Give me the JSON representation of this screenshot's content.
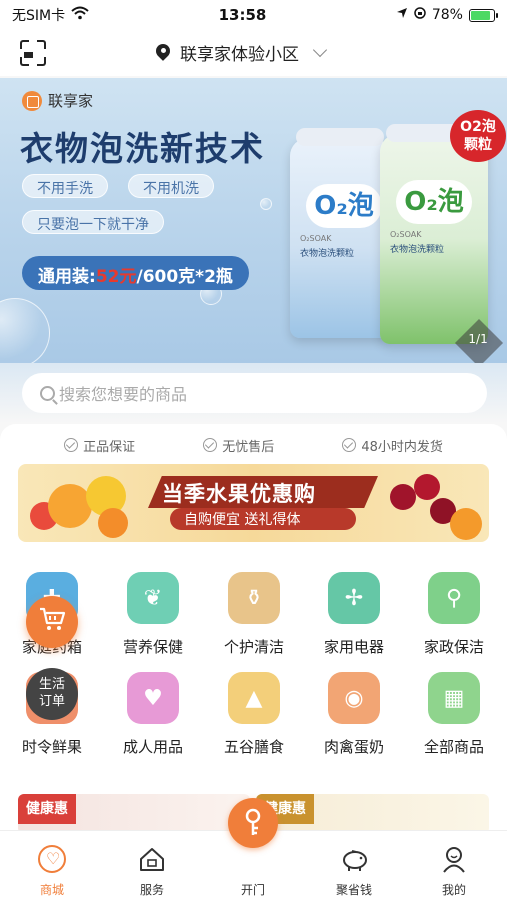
{
  "status_bar": {
    "carrier": "无SIM卡",
    "time": "13:58",
    "battery": "78%"
  },
  "header": {
    "location": "联享家体验小区"
  },
  "banner": {
    "brand": "联享家",
    "title": "衣物泡洗新技术",
    "pills": [
      "不用手洗",
      "不用机洗",
      "只要泡一下就干净"
    ],
    "price_prefix": "通用装:",
    "price_value": "52元",
    "price_suffix": "/600克*2瓶",
    "product_logo": "O₂泡",
    "product_name": "衣物泡洗颗粒",
    "product_brand": "O₂SOAK",
    "badge_line1": "O2泡",
    "badge_line2": "颗粒",
    "page_indicator": "1/1"
  },
  "search": {
    "placeholder": "搜索您想要的商品"
  },
  "guarantees": [
    "正品保证",
    "无忧售后",
    "48小时内发货"
  ],
  "fruit_banner": {
    "title": "当季水果优惠购",
    "subtitle": "自购便宜 送礼得体"
  },
  "categories": [
    {
      "label": "家庭药箱",
      "color": "#5aaee0",
      "icon": "medicine-box-icon"
    },
    {
      "label": "营养保健",
      "color": "#6fcfb4",
      "icon": "leaf-icon"
    },
    {
      "label": "个护清洁",
      "color": "#e8c48a",
      "icon": "lotion-bottle-icon"
    },
    {
      "label": "家用电器",
      "color": "#65c7a6",
      "icon": "fan-icon"
    },
    {
      "label": "家政保洁",
      "color": "#7fd08a",
      "icon": "broom-icon"
    },
    {
      "label": "时令鲜果",
      "color": "#ef8f6a",
      "icon": "fruit-icon"
    },
    {
      "label": "成人用品",
      "color": "#e79ad6",
      "icon": "heart-icon"
    },
    {
      "label": "五谷膳食",
      "color": "#f3cf7a",
      "icon": "grain-icon"
    },
    {
      "label": "肉禽蛋奶",
      "color": "#f2a574",
      "icon": "egg-icon"
    },
    {
      "label": "全部商品",
      "color": "#8fd48d",
      "icon": "grid-icon"
    }
  ],
  "floating": {
    "order_line1": "生活",
    "order_line2": "订单"
  },
  "promos": [
    {
      "tag": "健康惠"
    },
    {
      "tag": "健康惠"
    }
  ],
  "tabs": [
    {
      "label": "商城"
    },
    {
      "label": "服务"
    },
    {
      "label": "开门"
    },
    {
      "label": "聚省钱"
    },
    {
      "label": "我的"
    }
  ]
}
